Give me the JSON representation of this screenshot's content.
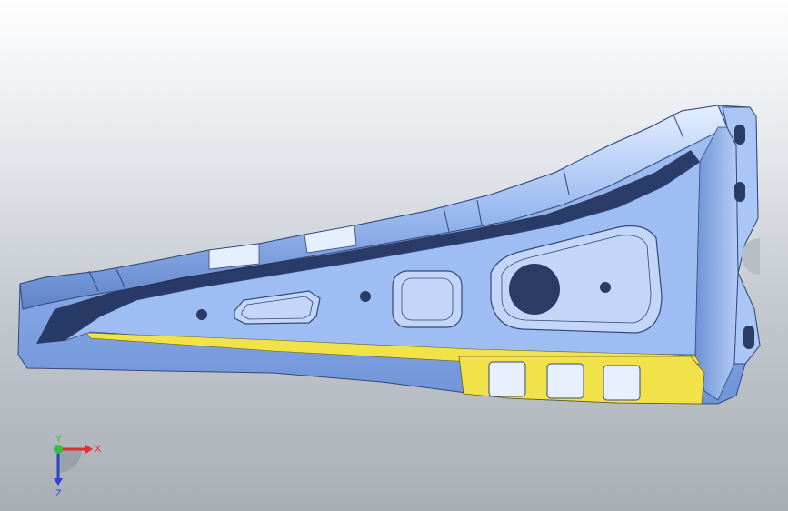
{
  "viewport": {
    "background_top": "#ffffff",
    "background_bottom": "#a9aeb5"
  },
  "part": {
    "body_color": "#8fb3f0",
    "body_highlight": "#dbe8ff",
    "body_shadow": "#1f2f5a",
    "face_color": "#f1e24a",
    "edge_color": "#2c3f6e"
  },
  "triad": {
    "x_label": "X",
    "y_label": "Y",
    "z_label": "Z",
    "x_color": "#e03030",
    "y_color": "#30c040",
    "z_color": "#3040d0"
  }
}
